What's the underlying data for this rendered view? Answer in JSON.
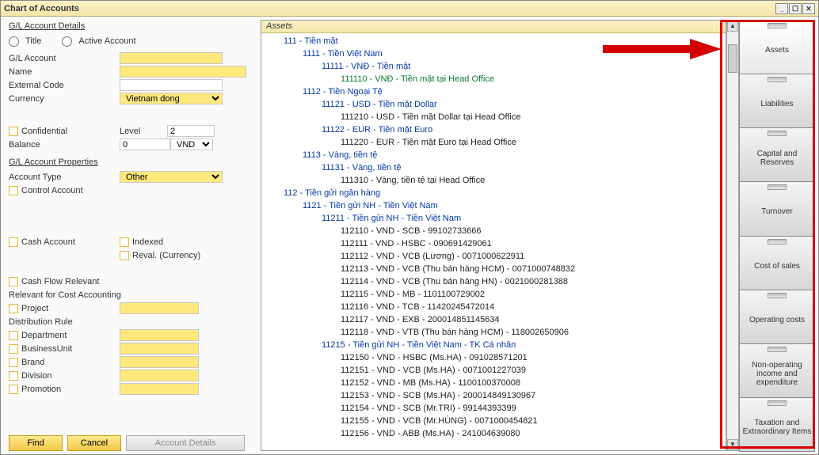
{
  "window": {
    "title": "Chart of Accounts"
  },
  "left": {
    "section_details": "G/L Account Details",
    "radio_title": "Title",
    "radio_active": "Active Account",
    "gl_account": "G/L Account",
    "name": "Name",
    "external_code": "External Code",
    "currency": "Currency",
    "currency_value": "Vietnam dong",
    "confidential": "Confidential",
    "level": "Level",
    "level_value": "2",
    "balance": "Balance",
    "balance_value": "0",
    "balance_unit": "VND",
    "section_props": "G/L Account Properties",
    "account_type": "Account Type",
    "account_type_value": "Other",
    "control_account": "Control Account",
    "cash_account": "Cash Account",
    "indexed": "Indexed",
    "reval": "Reval. (Currency)",
    "cash_flow": "Cash Flow Relevant",
    "relevant_cost": "Relevant for Cost Accounting",
    "project": "Project",
    "distribution_rule": "Distribution Rule",
    "department": "Department",
    "business_unit": "BusinessUnit",
    "brand": "Brand",
    "division": "Division",
    "promotion": "Promotion",
    "btn_find": "Find",
    "btn_cancel": "Cancel",
    "btn_details": "Account Details"
  },
  "tree": {
    "header": "Assets",
    "nodes": [
      {
        "l": 1,
        "c": "blue",
        "t": "111 - Tiền mặt"
      },
      {
        "l": 2,
        "c": "blue",
        "t": "1111 - Tiền Việt Nam"
      },
      {
        "l": 3,
        "c": "blue",
        "t": "11111 - VNĐ - Tiền mặt"
      },
      {
        "l": 4,
        "c": "green",
        "t": "111110 - VNĐ - Tiền mặt tại Head Office"
      },
      {
        "l": 2,
        "c": "blue",
        "t": "1112 - Tiền Ngoại Tệ"
      },
      {
        "l": 3,
        "c": "blue",
        "t": "11121 - USD - Tiền mặt Dollar"
      },
      {
        "l": 4,
        "c": "black",
        "t": "111210 - USD - Tiền mặt Dollar tại Head Office"
      },
      {
        "l": 3,
        "c": "blue",
        "t": "11122 - EUR - Tiền mặt Euro"
      },
      {
        "l": 4,
        "c": "black",
        "t": "111220 - EUR - Tiền mặt Euro tại Head Office"
      },
      {
        "l": 2,
        "c": "blue",
        "t": "1113 - Vàng, tiền tệ"
      },
      {
        "l": 3,
        "c": "blue",
        "t": "11131 - Vàng, tiền tệ"
      },
      {
        "l": 4,
        "c": "black",
        "t": "111310 - Vàng, tiền tệ tại Head Office"
      },
      {
        "l": 1,
        "c": "blue",
        "t": "112 - Tiền gửi ngân hàng"
      },
      {
        "l": 2,
        "c": "blue",
        "t": "1121 - Tiền gửi NH - Tiền Việt Nam"
      },
      {
        "l": 3,
        "c": "blue",
        "t": "11211 - Tiền gửi NH - Tiền Việt Nam"
      },
      {
        "l": 4,
        "c": "black",
        "t": "112110 - VND - SCB - 99102733666"
      },
      {
        "l": 4,
        "c": "black",
        "t": "112111 - VND - HSBC - 090691429061"
      },
      {
        "l": 4,
        "c": "black",
        "t": "112112 - VND - VCB (Lương) - 0071000622911"
      },
      {
        "l": 4,
        "c": "black",
        "t": "112113 - VND - VCB (Thu bán hàng HCM) - 0071000748832"
      },
      {
        "l": 4,
        "c": "black",
        "t": "112114 - VND - VCB (Thu bán hàng HN) - 0021000281388"
      },
      {
        "l": 4,
        "c": "black",
        "t": "112115 - VND - MB - 1101100729002"
      },
      {
        "l": 4,
        "c": "black",
        "t": "112116 - VND - TCB - 11420245472014"
      },
      {
        "l": 4,
        "c": "black",
        "t": "112117 - VND - EXB - 200014851145634"
      },
      {
        "l": 4,
        "c": "black",
        "t": "112118 - VND - VTB (Thu bán hàng HCM) - 118002650906"
      },
      {
        "l": 3,
        "c": "blue",
        "t": "11215 - Tiền gửi NH - Tiền Việt Nam - TK Cá nhân"
      },
      {
        "l": 4,
        "c": "black",
        "t": "112150 - VND - HSBC (Ms.HA) - 091028571201"
      },
      {
        "l": 4,
        "c": "black",
        "t": "112151 - VND - VCB (Ms.HA) - 0071001227039"
      },
      {
        "l": 4,
        "c": "black",
        "t": "112152 - VND - MB (Ms.HA) - 1100100370008"
      },
      {
        "l": 4,
        "c": "black",
        "t": "112153 - VND - SCB (Ms.HA) -  200014849130967"
      },
      {
        "l": 4,
        "c": "black",
        "t": "112154 - VND - SCB (Mr.TRI) -  99144393399"
      },
      {
        "l": 4,
        "c": "black",
        "t": "112155 - VND - VCB (Mr.HÙNG)  -  0071000454821"
      },
      {
        "l": 4,
        "c": "black",
        "t": "112156 - VND - ABB (Ms.HA) -  241004639080"
      }
    ]
  },
  "drawers": [
    "Assets",
    "Liabilities",
    "Capital and Reserves",
    "Turnover",
    "Cost of sales",
    "Operating costs",
    "Non-operating income and expenditure",
    "Taxation and Extraordinary Items"
  ]
}
